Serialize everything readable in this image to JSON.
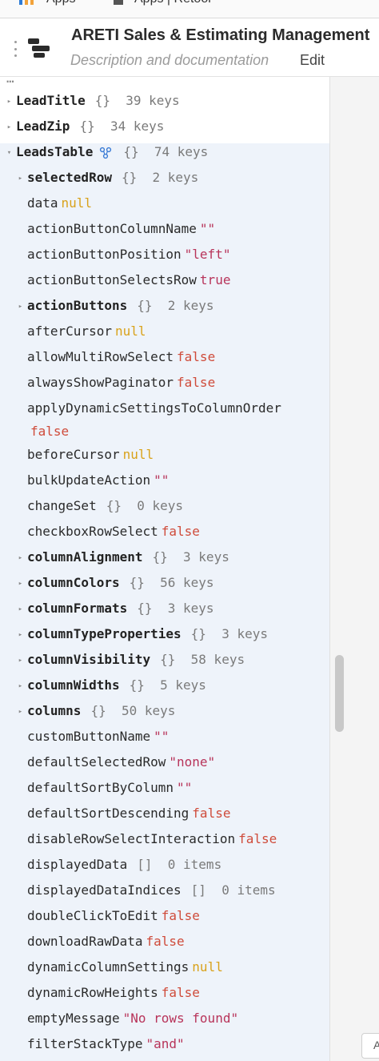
{
  "tabs": [
    {
      "label": "Apps",
      "icon": "bar-chart-icon"
    },
    {
      "label": "Apps | Retool",
      "icon": "document-icon"
    }
  ],
  "header": {
    "title": "ARETI Sales & Estimating Management",
    "description_placeholder": "Description and documentation",
    "edit_label": "Edit"
  },
  "tree": {
    "rows": [
      {
        "key": "LeadTitle",
        "type": "object",
        "meta": "{}  39 keys",
        "indent": 0,
        "bold": true,
        "expanded": false
      },
      {
        "key": "LeadZip",
        "type": "object",
        "meta": "{}  34 keys",
        "indent": 0,
        "bold": true,
        "expanded": false
      },
      {
        "key": "LeadsTable",
        "type": "object",
        "meta": "{}  74 keys",
        "indent": 0,
        "bold": true,
        "expanded": true,
        "has_icon": true
      },
      {
        "key": "selectedRow",
        "type": "object",
        "meta": "{}  2 keys",
        "indent": 1,
        "bold": true,
        "expanded": false
      },
      {
        "key": "data",
        "type": "null",
        "value": "null",
        "indent": 1
      },
      {
        "key": "actionButtonColumnName",
        "type": "str",
        "value": "\"\"",
        "indent": 1
      },
      {
        "key": "actionButtonPosition",
        "type": "str",
        "value": "\"left\"",
        "indent": 1
      },
      {
        "key": "actionButtonSelectsRow",
        "type": "true",
        "value": "true",
        "indent": 1
      },
      {
        "key": "actionButtons",
        "type": "object",
        "meta": "{}  2 keys",
        "indent": 1,
        "bold": true,
        "expanded": false
      },
      {
        "key": "afterCursor",
        "type": "null",
        "value": "null",
        "indent": 1
      },
      {
        "key": "allowMultiRowSelect",
        "type": "false",
        "value": "false",
        "indent": 1
      },
      {
        "key": "alwaysShowPaginator",
        "type": "false",
        "value": "false",
        "indent": 1
      },
      {
        "key": "applyDynamicSettingsToColumnOrder",
        "type": "false",
        "value": "false",
        "indent": 1,
        "wrap": true
      },
      {
        "key": "beforeCursor",
        "type": "null",
        "value": "null",
        "indent": 1
      },
      {
        "key": "bulkUpdateAction",
        "type": "str",
        "value": "\"\"",
        "indent": 1
      },
      {
        "key": "changeSet",
        "type": "meta",
        "meta": "{}  0 keys",
        "indent": 1
      },
      {
        "key": "checkboxRowSelect",
        "type": "false",
        "value": "false",
        "indent": 1
      },
      {
        "key": "columnAlignment",
        "type": "object",
        "meta": "{}  3 keys",
        "indent": 1,
        "bold": true,
        "expanded": false
      },
      {
        "key": "columnColors",
        "type": "object",
        "meta": "{}  56 keys",
        "indent": 1,
        "bold": true,
        "expanded": false
      },
      {
        "key": "columnFormats",
        "type": "object",
        "meta": "{}  3 keys",
        "indent": 1,
        "bold": true,
        "expanded": false
      },
      {
        "key": "columnTypeProperties",
        "type": "object",
        "meta": "{}  3 keys",
        "indent": 1,
        "bold": true,
        "expanded": false
      },
      {
        "key": "columnVisibility",
        "type": "object",
        "meta": "{}  58 keys",
        "indent": 1,
        "bold": true,
        "expanded": false
      },
      {
        "key": "columnWidths",
        "type": "object",
        "meta": "{}  5 keys",
        "indent": 1,
        "bold": true,
        "expanded": false
      },
      {
        "key": "columns",
        "type": "object",
        "meta": "{}  50 keys",
        "indent": 1,
        "bold": true,
        "expanded": false
      },
      {
        "key": "customButtonName",
        "type": "str",
        "value": "\"\"",
        "indent": 1
      },
      {
        "key": "defaultSelectedRow",
        "type": "str",
        "value": "\"none\"",
        "indent": 1
      },
      {
        "key": "defaultSortByColumn",
        "type": "str",
        "value": "\"\"",
        "indent": 1
      },
      {
        "key": "defaultSortDescending",
        "type": "false",
        "value": "false",
        "indent": 1
      },
      {
        "key": "disableRowSelectInteraction",
        "type": "false",
        "value": "false",
        "indent": 1
      },
      {
        "key": "displayedData",
        "type": "meta",
        "meta": "[]  0 items",
        "indent": 1
      },
      {
        "key": "displayedDataIndices",
        "type": "meta",
        "meta": "[]  0 items",
        "indent": 1
      },
      {
        "key": "doubleClickToEdit",
        "type": "false",
        "value": "false",
        "indent": 1
      },
      {
        "key": "downloadRawData",
        "type": "false",
        "value": "false",
        "indent": 1
      },
      {
        "key": "dynamicColumnSettings",
        "type": "null",
        "value": "null",
        "indent": 1
      },
      {
        "key": "dynamicRowHeights",
        "type": "false",
        "value": "false",
        "indent": 1
      },
      {
        "key": "emptyMessage",
        "type": "str",
        "value": "\"No rows found\"",
        "indent": 1
      },
      {
        "key": "filterStackType",
        "type": "str",
        "value": "\"and\"",
        "indent": 1
      }
    ]
  },
  "corner_button": {
    "label": "A"
  },
  "colors": {
    "selected_bg": "#eef3fa",
    "null": "#d9a21b",
    "string": "#b8345a",
    "boolean_false": "#cf4b3a",
    "meta": "#7a7a7a"
  }
}
